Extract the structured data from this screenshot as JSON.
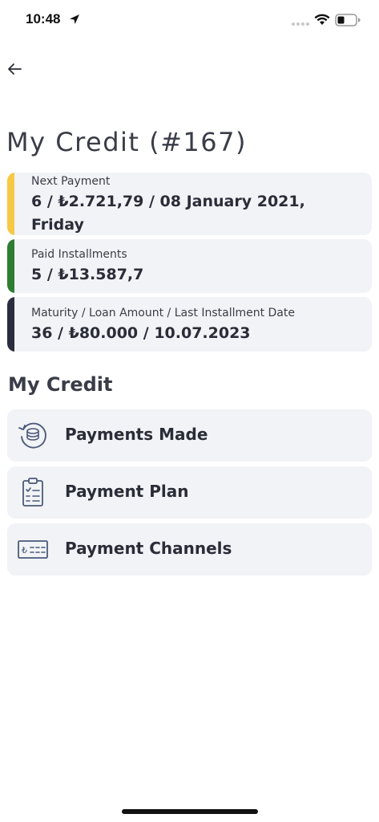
{
  "status_bar": {
    "time": "10:48",
    "icons": [
      "location-arrow-icon",
      "signal-icon",
      "wifi-icon",
      "battery-icon"
    ]
  },
  "header": {
    "back_icon": "arrow-left-icon",
    "title": "My Credit (#167)"
  },
  "info_cards": [
    {
      "label": "Next Payment",
      "value": "6  /  ₺2.721,79  /  08 January 2021, Friday",
      "accent": "#f5c945"
    },
    {
      "label": "Paid Installments",
      "value": "5  /  ₺13.587,7",
      "accent": "#2e7d32"
    },
    {
      "label": "Maturity / Loan Amount / Last Installment Date",
      "value": "36  /  ₺80.000 / 10.07.2023",
      "accent": "#2a2d3e"
    }
  ],
  "section": {
    "title": "My Credit"
  },
  "menu": [
    {
      "label": "Payments Made",
      "icon": "coins-history-icon"
    },
    {
      "label": "Payment Plan",
      "icon": "clipboard-checklist-icon"
    },
    {
      "label": "Payment Channels",
      "icon": "lira-card-icon"
    }
  ],
  "colors": {
    "background": "#ffffff",
    "card_background": "#f2f3f6",
    "text": "#2a2d38"
  }
}
